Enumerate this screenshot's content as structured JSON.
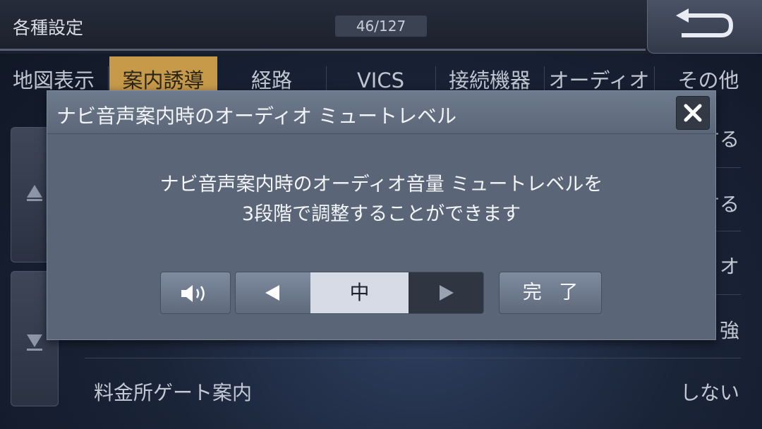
{
  "header": {
    "title": "各種設定",
    "counter": "46/127",
    "back_icon": "return-arrow-icon"
  },
  "tabs": [
    {
      "label": "地図表示",
      "active": false
    },
    {
      "label": "案内誘導",
      "active": true
    },
    {
      "label": "経路",
      "active": false
    },
    {
      "label": "VICS",
      "active": false
    },
    {
      "label": "接続機器",
      "active": false
    },
    {
      "label": "オーディオ",
      "active": false
    },
    {
      "label": "その他",
      "active": false
    }
  ],
  "list": {
    "partial_values": [
      "する",
      "する",
      "ィオ",
      "強"
    ],
    "last_row": {
      "label": "料金所ゲート案内",
      "value": "しない"
    }
  },
  "dialog": {
    "title": "ナビ音声案内時のオーディオ ミュートレベル",
    "message_line1": "ナビ音声案内時のオーディオ音量 ミュートレベルを",
    "message_line2": "3段階で調整することができます",
    "stepper_value": "中",
    "done_label": "完 了"
  },
  "colors": {
    "active_tab": "#c79a4a",
    "dialog_bg": "#5a6677",
    "stepper_value_bg": "#d6dbe5"
  }
}
